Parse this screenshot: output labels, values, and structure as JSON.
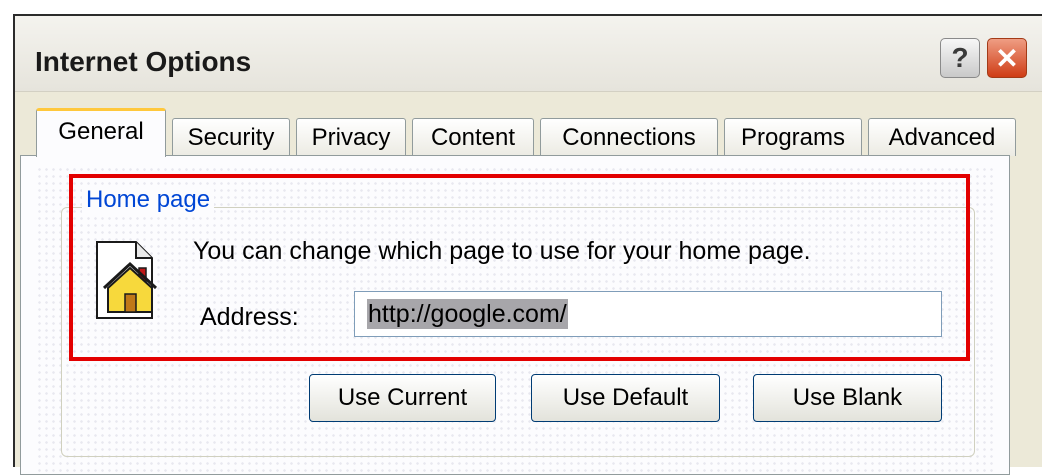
{
  "window": {
    "title": "Internet Options",
    "help_label": "?",
    "close_label": "✕"
  },
  "tabs": [
    {
      "label": "General",
      "active": true
    },
    {
      "label": "Security",
      "active": false
    },
    {
      "label": "Privacy",
      "active": false
    },
    {
      "label": "Content",
      "active": false
    },
    {
      "label": "Connections",
      "active": false
    },
    {
      "label": "Programs",
      "active": false
    },
    {
      "label": "Advanced",
      "active": false
    }
  ],
  "home_page": {
    "group_label": "Home page",
    "description": "You can change which page to use for your home page.",
    "address_label": "Address:",
    "address_value": "http://google.com/",
    "icon": "home-page-icon"
  },
  "buttons": {
    "use_current": "Use Current",
    "use_default": "Use Default",
    "use_blank": "Use Blank"
  },
  "colors": {
    "group_label": "#0046d5",
    "highlight": "#e30000",
    "active_tab_accent": "#ffc83c",
    "close_button": "#cf3d16"
  }
}
